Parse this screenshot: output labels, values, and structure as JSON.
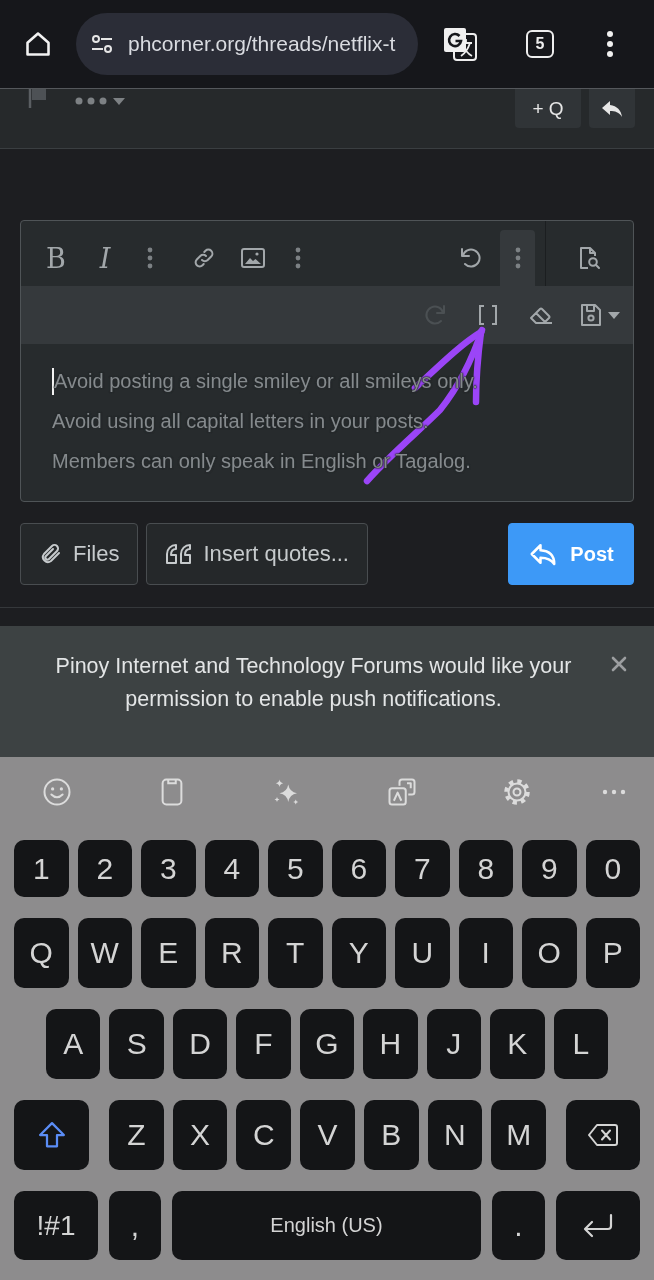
{
  "browser_bar": {
    "url": "phcorner.org/threads/netflix-t",
    "tab_count": "5"
  },
  "post_actions": {
    "quote_button": "+ Q"
  },
  "editor": {
    "toolbar_left": [
      {
        "kind": "bold",
        "label": "B",
        "active": false,
        "disabled": false
      },
      {
        "kind": "italic",
        "label": "I",
        "active": false,
        "disabled": false
      },
      {
        "kind": "more",
        "active": false,
        "disabled": false
      },
      {
        "kind": "link",
        "active": false,
        "disabled": false
      },
      {
        "kind": "image",
        "active": false,
        "disabled": false
      },
      {
        "kind": "more",
        "active": false,
        "disabled": false
      }
    ],
    "toolbar_right": [
      {
        "kind": "undo",
        "active": false,
        "disabled": false
      },
      {
        "kind": "more",
        "active": true,
        "disabled": false
      },
      {
        "kind": "preview",
        "active": false,
        "disabled": false
      }
    ],
    "toolbar_row_2": [
      {
        "kind": "redo",
        "disabled": true
      },
      {
        "kind": "source",
        "disabled": false
      },
      {
        "kind": "eraser",
        "disabled": false
      },
      {
        "kind": "drafts",
        "disabled": false
      }
    ],
    "focused": true,
    "placeholder": [
      "Avoid posting a single smiley or all smileys only.",
      "Avoid using all capital letters in your posts.",
      "Members can only speak in English or Tagalog."
    ]
  },
  "actions": [
    {
      "kind": "attach",
      "label": "Files"
    },
    {
      "kind": "quote",
      "label": "Insert quotes..."
    },
    {
      "kind": "post",
      "label": "Post"
    }
  ],
  "notification": {
    "message": "Pinoy Internet and Technology Forums would like your permission to enable push notifications."
  },
  "keyboard": {
    "number_row": [
      "1",
      "2",
      "3",
      "4",
      "5",
      "6",
      "7",
      "8",
      "9",
      "0"
    ],
    "letter_rows": [
      [
        "Q",
        "W",
        "E",
        "R",
        "T",
        "Y",
        "U",
        "I",
        "O",
        "P"
      ],
      [
        "A",
        "S",
        "D",
        "F",
        "G",
        "H",
        "J",
        "K",
        "L"
      ],
      [
        "Z",
        "X",
        "C",
        "V",
        "B",
        "N",
        "M"
      ]
    ],
    "shift_on": true,
    "symbols_key": "!#1",
    "comma_key": ",",
    "space_key": "English (US)",
    "period_key": "."
  },
  "annotations": [
    {
      "kind": "arrow"
    }
  ]
}
